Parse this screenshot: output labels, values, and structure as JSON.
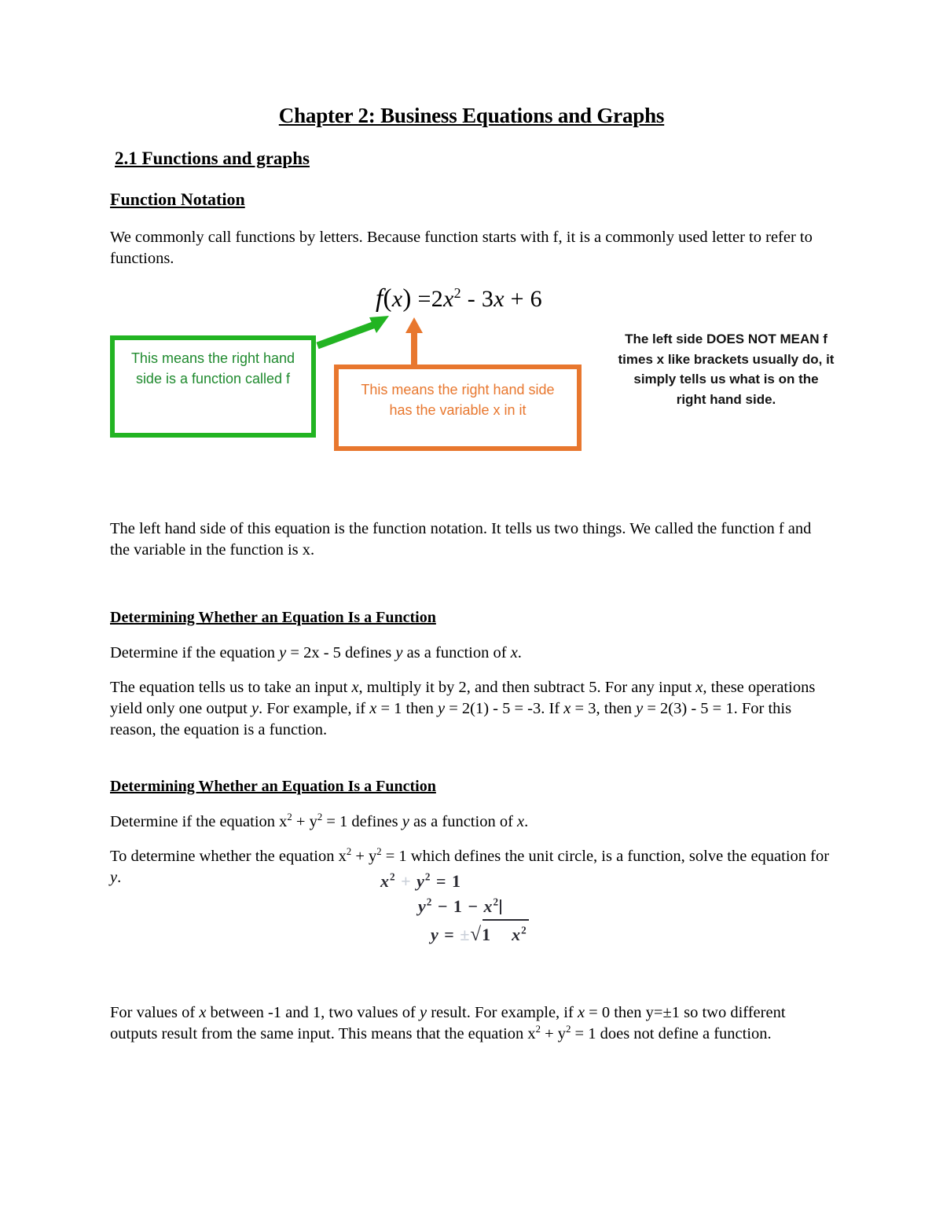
{
  "document": {
    "title": "Chapter 2: Business Equations and Graphs",
    "section_heading": "2.1 Functions and graphs",
    "subsection_1": {
      "heading": "Function Notation",
      "intro_line_1": "We commonly call functions by letters.  Because function starts with f, it is a commonly used",
      "intro_line_2": "letter to refer to functions.",
      "equation": {
        "function_name": "f",
        "variable": "x",
        "rhs": "2x² - 3x + 6",
        "full": "f(x) = 2x² - 3x + 6",
        "lhs_label": "f(x)",
        "equals": "=",
        "term_1_coefficient": "2",
        "term_1_variable": "x",
        "term_1_exponent": "2",
        "term_2": "- 3x",
        "term_3": "+ 6"
      },
      "callout_green": {
        "text": "This means the right hand side is a function called f",
        "line_1": "This means the right hand",
        "line_2": "side is a function called f",
        "border_color": "#22B422",
        "text_color": "#1F8A2E"
      },
      "callout_orange": {
        "text": "This means the right hand side has the variable x in it",
        "line_1": "This means the right hand side",
        "line_2": "has the variable x in it",
        "border_color": "#E8772E",
        "text_color": "#E8772E"
      },
      "note_right": {
        "line_1": "The left side DOES NOT MEAN f",
        "line_2": "times x like brackets usually do, it",
        "line_3": "simply tells us what is on the",
        "line_4": "right hand side."
      },
      "paragraph_after": "The left hand side of this equation is the function notation.  It tells us two things.  We called the function f and the variable in the function is x."
    },
    "subsection_2": {
      "heading": "Determining Whether an Equation Is a Function",
      "prompt": "Determine if the equation y = 2x - 5 defines y as a function of x.",
      "explanation": "The equation tells us to take an input x, multiply it by 2, and then subtract 5. For any input x, these operations yield only one output y. For example, if x = 1 then y = 2(1) - 5 = -3. If x = 3, then y = 2(3) - 5 = 1. For this reason, the equation is a function."
    },
    "subsection_3": {
      "heading": "Determining Whether an Equation Is a Function",
      "prompt": "Determine if the equation x² + y² = 1 defines y as a function of x.",
      "explanation": "To determine whether the equation x² + y² = 1 which defines the unit circle, is a function, solve the equation for y.",
      "derivation": {
        "line_1": "x² + y² = 1",
        "line_2": "y² = 1 − x²",
        "line_3": "y = ±√(1 − x²)",
        "line_1_parts": {
          "lhs": "x",
          "lhs_exp": "2",
          "operator": "+",
          "rhs": "y",
          "rhs_exp": "2",
          "equals": "=",
          "value": "1"
        },
        "line_2_parts": {
          "lhs": "y",
          "lhs_exp": "2",
          "equals": "=",
          "one": "1",
          "minus": "−",
          "x": "x",
          "x_exp": "2"
        },
        "line_3_parts": {
          "lhs": "y",
          "equals": "=",
          "plusminus": "±",
          "radical": "√",
          "one": "1",
          "minus": "−",
          "x": "x",
          "x_exp": "2"
        }
      },
      "conclusion": "For values of x between -1 and 1, two values of y result. For example, if x = 0 then y=±1 so two different outputs result from the same input. This means that the equation x² + y² = 1  does not define a function."
    }
  }
}
